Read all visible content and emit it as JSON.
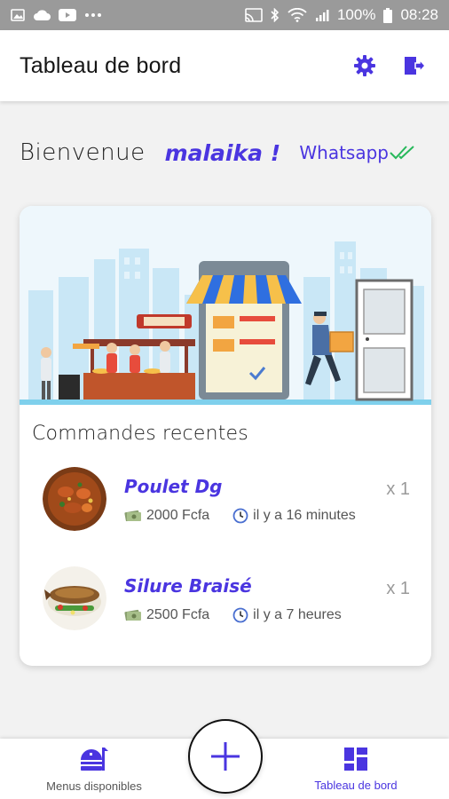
{
  "status_bar": {
    "battery": "100%",
    "time": "08:28"
  },
  "appbar": {
    "title": "Tableau de bord",
    "settings_icon": "gear-icon",
    "logout_icon": "logout-icon"
  },
  "welcome": {
    "label": "Bienvenue",
    "name": "malaika !",
    "whatsapp_label": "Whatsapp"
  },
  "recent_orders": {
    "heading": "Commandes recentes",
    "items": [
      {
        "name": "Poulet Dg",
        "price": "2000 Fcfa",
        "time": "il y a 16 minutes",
        "quantity": "x 1"
      },
      {
        "name": "Silure Braisé",
        "price": "2500 Fcfa",
        "time": "il y a 7 heures",
        "quantity": "x 1"
      }
    ]
  },
  "bottom_nav": {
    "items": [
      {
        "label": "Menus disponibles",
        "icon": "food-menu-icon",
        "active": false
      },
      {
        "label": "Tableau de bord",
        "icon": "dashboard-icon",
        "active": true
      }
    ],
    "fab_icon": "plus-icon"
  },
  "colors": {
    "accent": "#4a35e0",
    "whatsapp_check": "#26b85a",
    "status_bar": "#9a9a9a"
  }
}
